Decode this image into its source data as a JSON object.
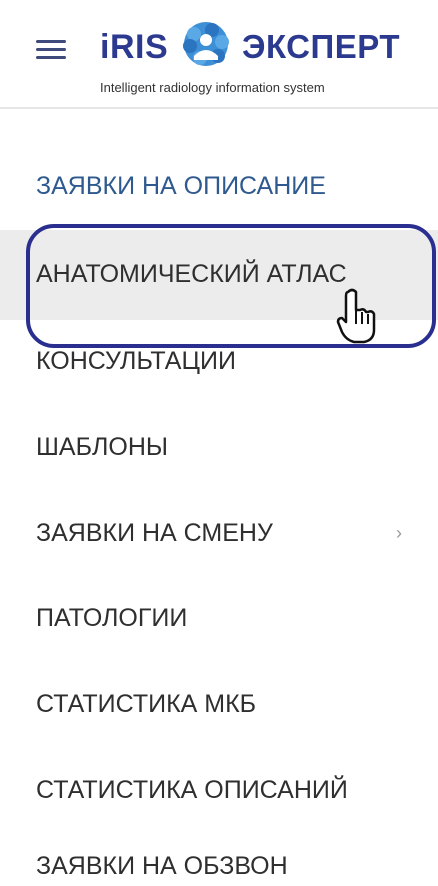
{
  "header": {
    "logo_left": "iRIS",
    "logo_right": "ЭКСПЕРТ",
    "tagline": "Intelligent radiology information system",
    "brand_color": "#2b3a8f"
  },
  "nav": {
    "section_title": "ЗАЯВКИ НА ОПИСАНИЕ",
    "items": [
      {
        "label": "АНАТОМИЧЕСКИЙ АТЛАС"
      },
      {
        "label": "КОНСУЛЬТАЦИИ"
      },
      {
        "label": "ШАБЛОНЫ"
      },
      {
        "label": "ЗАЯВКИ НА СМЕНУ",
        "chevron": "›"
      },
      {
        "label": "ПАТОЛОГИИ"
      },
      {
        "label": "СТАТИСТИКА МКБ"
      },
      {
        "label": "СТАТИСТИКА ОПИСАНИЙ"
      },
      {
        "label": "ЗАЯВКИ НА ОБЗВОН"
      }
    ]
  },
  "colors": {
    "highlight_ring": "#2a2f8f",
    "active_bg": "#ececec",
    "section_text": "#2f5a8f"
  },
  "icons": {
    "menu": "hamburger-icon",
    "cursor": "hand-pointer-icon",
    "logo_mark": "brain-icon"
  }
}
